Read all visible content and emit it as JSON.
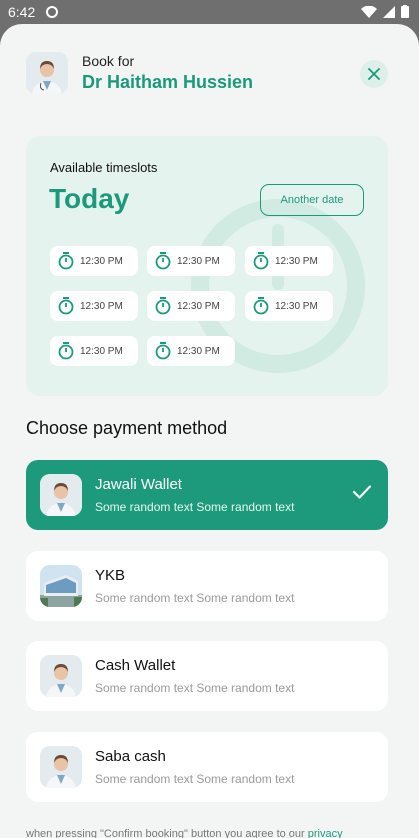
{
  "status_bar": {
    "time": "6:42"
  },
  "header": {
    "book_for_label": "Book for",
    "doctor_name": "Dr Haitham Hussien"
  },
  "slots": {
    "title": "Available timeslots",
    "day": "Today",
    "another_date_label": "Another date",
    "times": [
      "12:30 PM",
      "12:30 PM",
      "12:30 PM",
      "12:30 PM",
      "12:30 PM",
      "12:30 PM",
      "12:30 PM",
      "12:30 PM"
    ]
  },
  "payment": {
    "title": "Choose payment method",
    "methods": [
      {
        "name": "Jawali Wallet",
        "sub": "Some random text Some random text",
        "selected": true
      },
      {
        "name": "YKB",
        "sub": "Some random text Some random text",
        "selected": false
      },
      {
        "name": "Cash Wallet",
        "sub": "Some random text Some random text",
        "selected": false
      },
      {
        "name": "Saba cash",
        "sub": "Some random text Some random text",
        "selected": false
      }
    ]
  },
  "footer": {
    "note": "when pressing \"Confirm booking\" button you agree to our",
    "link": "privacy"
  },
  "colors": {
    "accent": "#1a9a7a",
    "card_bg": "#e5f3ef",
    "sheet_bg": "#f3f5f5"
  }
}
